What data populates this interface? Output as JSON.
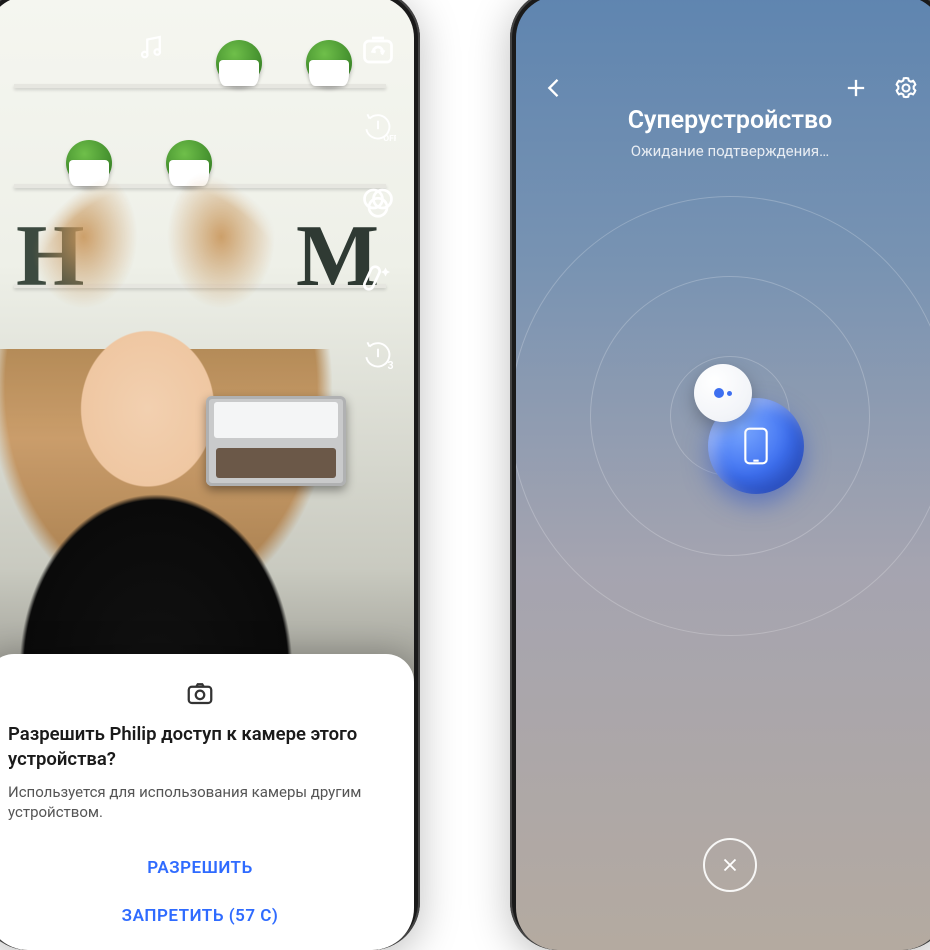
{
  "left": {
    "icons": {
      "music": "music-icon",
      "switchCamera": "switch-camera-icon",
      "timerOff": "timer-off-icon",
      "timerOffLabel": "OFF",
      "filters": "filters-icon",
      "beauty": "beauty-wand-icon",
      "timer3": "timer-3s-icon",
      "timer3Label": "3"
    },
    "dialog": {
      "title": "Разрешить Philip доступ к камере этого устройства?",
      "description": "Используется для использования камеры другим устройством.",
      "allowLabel": "РАЗРЕШИТЬ",
      "denyLabel": "ЗАПРЕТИТЬ (57 C)"
    }
  },
  "right": {
    "title": "Суперустройство",
    "subtitle": "Ожидание подтверждения…",
    "header": {
      "back": "back-icon",
      "add": "add-icon",
      "settings": "settings-icon"
    },
    "orbs": {
      "primary": "phone-device-orb",
      "secondary": "connecting-device-orb"
    },
    "close": "close-button"
  }
}
